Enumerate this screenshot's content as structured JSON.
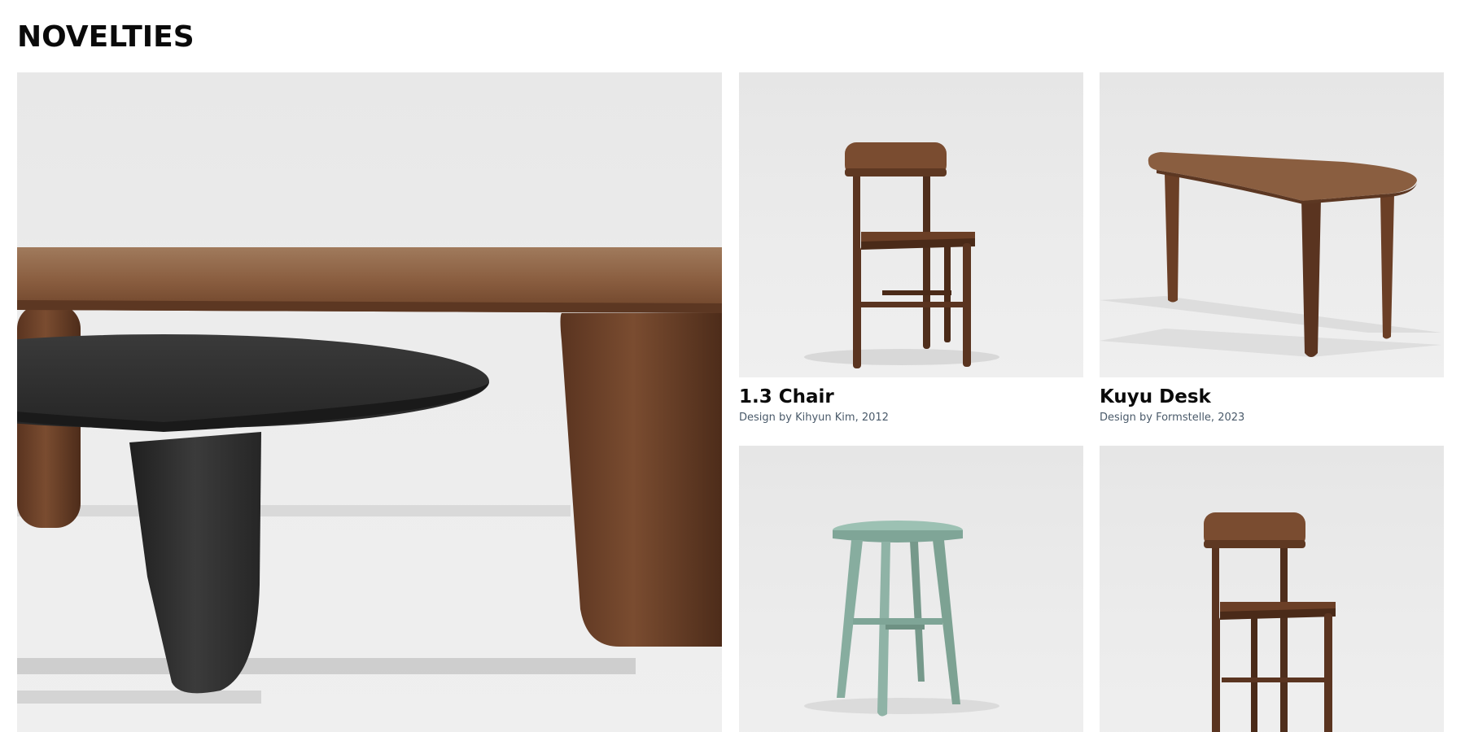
{
  "section": {
    "title": "NOVELTIES"
  },
  "hero": {
    "image": "hero-table-photo"
  },
  "products": [
    {
      "name": "1.3 Chair",
      "credit": "Design by Kihyun Kim, 2012",
      "image": "chair-photo"
    },
    {
      "name": "Kuyu Desk",
      "credit": "Design by Formstelle, 2023",
      "image": "desk-photo"
    },
    {
      "name": "",
      "credit": "",
      "image": "stool-photo"
    },
    {
      "name": "",
      "credit": "",
      "image": "chair-photo"
    }
  ],
  "colors": {
    "walnut": "#6b3f26",
    "walnut_dark": "#4a2a18",
    "black_oak": "#2d2d2d",
    "sage": "#8fb3a6",
    "background": "#ececec"
  }
}
